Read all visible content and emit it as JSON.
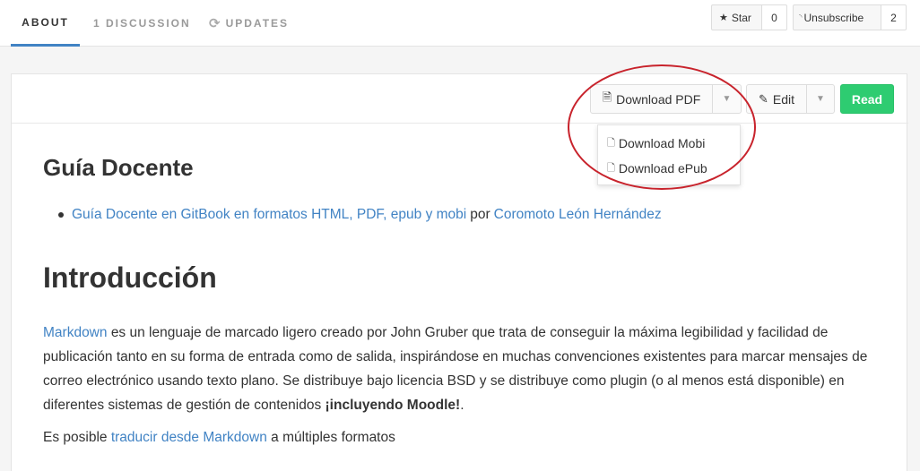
{
  "tabs": {
    "about": "ABOUT",
    "discussion": "1 DISCUSSION",
    "updates": "UPDATES"
  },
  "github_buttons": {
    "star_label": "Star",
    "star_count": "0",
    "unsubscribe_label": "Unsubscribe",
    "unsubscribe_count": "2"
  },
  "toolbar": {
    "download_pdf": "Download PDF",
    "edit": "Edit",
    "read": "Read"
  },
  "dropdown": {
    "items": [
      "Download Mobi",
      "Download ePub"
    ]
  },
  "content": {
    "heading_guia": "Guía Docente",
    "guia_link": "Guía Docente en GitBook en formatos HTML, PDF, epub y mobi",
    "guia_por": "por",
    "author_link": "Coromoto León Hernández",
    "heading_intro": "Introducción",
    "markdown_link": "Markdown",
    "para1_text": "es un lenguaje de marcado ligero creado por John Gruber que trata de conseguir la máxima legibilidad y facilidad de publicación tanto en su forma de entrada como de salida, inspirándose en muchas convenciones existentes para marcar mensajes de correo electrónico usando texto plano. Se distribuye bajo licencia BSD y se distribuye como plugin (o al menos está disponible) en diferentes sistemas de gestión de contenidos",
    "para1_bold": "¡incluyendo Moodle!",
    "para1_end": ".",
    "para2_start": "Es posible",
    "para2_link": "traducir desde Markdown",
    "para2_end": "a múltiples formatos"
  },
  "colors": {
    "link": "#4183c4",
    "read_button": "#2ecc71",
    "annotation": "#c8232c"
  }
}
